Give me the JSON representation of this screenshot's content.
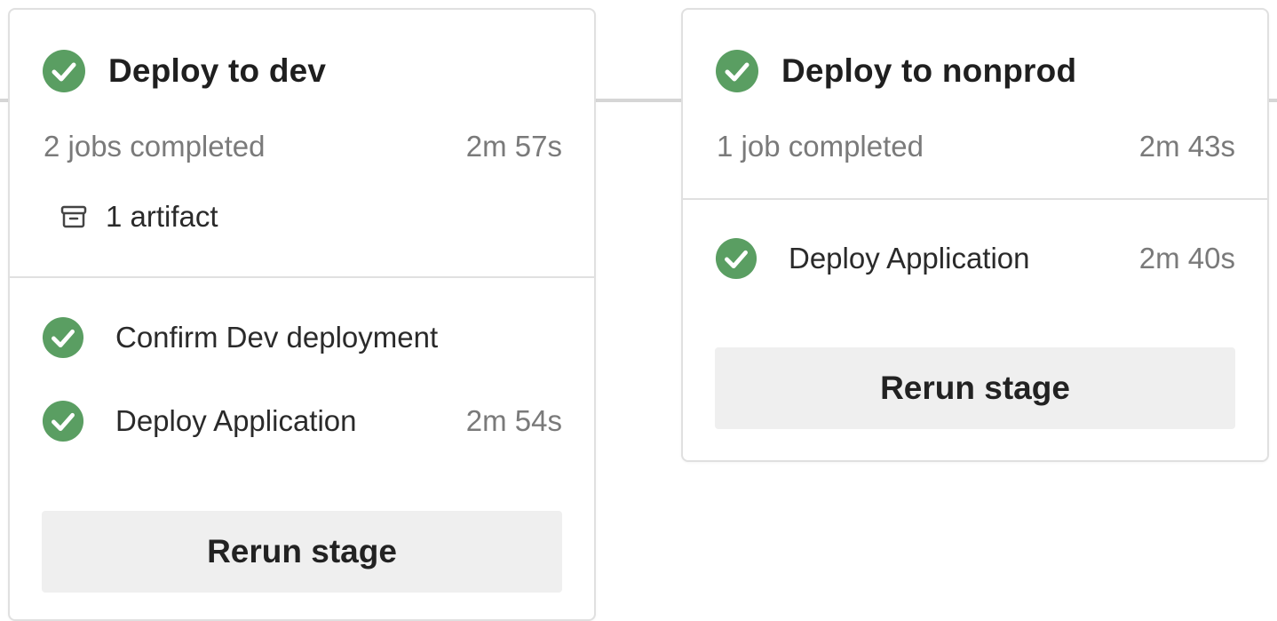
{
  "colors": {
    "success_green": "#5a9e62",
    "muted_text": "#7a7a7a",
    "button_bg": "#efefef",
    "border": "#e0e0e0"
  },
  "stages": [
    {
      "title": "Deploy to dev",
      "status_icon": "check-circle-icon",
      "jobs_summary": "2 jobs completed",
      "duration": "2m 57s",
      "artifact_icon": "archive-icon",
      "artifacts": "1 artifact",
      "jobs": [
        {
          "name": "Confirm Dev deployment",
          "duration": "",
          "status_icon": "check-circle-icon"
        },
        {
          "name": "Deploy Application",
          "duration": "2m 54s",
          "status_icon": "check-circle-icon"
        }
      ],
      "rerun_label": "Rerun stage"
    },
    {
      "title": "Deploy to nonprod",
      "status_icon": "check-circle-icon",
      "jobs_summary": "1 job completed",
      "duration": "2m 43s",
      "jobs": [
        {
          "name": "Deploy Application",
          "duration": "2m 40s",
          "status_icon": "check-circle-icon"
        }
      ],
      "rerun_label": "Rerun stage"
    }
  ]
}
